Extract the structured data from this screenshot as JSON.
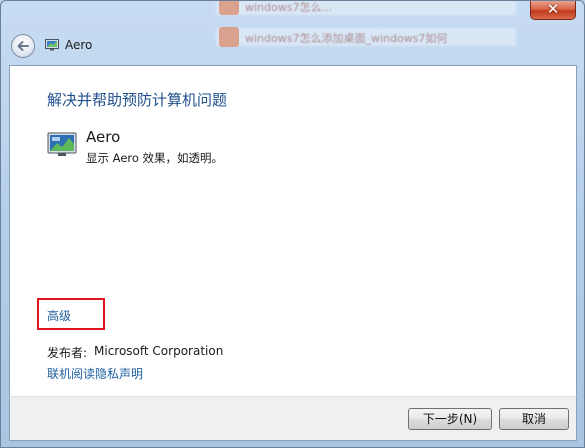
{
  "window": {
    "title": "Aero",
    "close_label": "✕",
    "background_text_1": "windows7怎么...",
    "background_text_2": "windows7怎么添加桌面_windows7如何"
  },
  "nav": {
    "back_icon": "back-arrow-icon",
    "app_icon": "monitor-icon"
  },
  "content": {
    "heading": "解决并帮助预防计算机问题",
    "item": {
      "icon": "aero-monitor-icon",
      "title": "Aero",
      "description": "显示 Aero 效果，如透明。"
    },
    "advanced_link": "高级",
    "publisher_label": "发布者:",
    "publisher_value": "Microsoft Corporation",
    "privacy_link": "联机阅读隐私声明"
  },
  "footer": {
    "next_button": "下一步(N)",
    "cancel_button": "取消"
  },
  "colors": {
    "accent_link": "#1f5f9f",
    "heading": "#1f4f8c",
    "highlight_box": "#e0141e",
    "close_button": "#c23b1c"
  }
}
